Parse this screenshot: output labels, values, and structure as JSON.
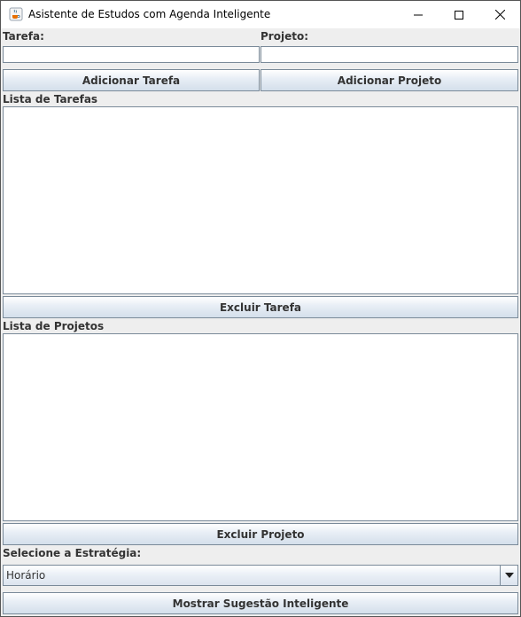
{
  "window": {
    "title": "Asistente de Estudos com Agenda Inteligente",
    "icon": "java-cup-icon"
  },
  "form": {
    "task_label": "Tarefa:",
    "task_value": "",
    "project_label": "Projeto:",
    "project_value": ""
  },
  "buttons": {
    "add_task": "Adicionar Tarefa",
    "add_project": "Adicionar Projeto",
    "delete_task": "Excluir Tarefa",
    "delete_project": "Excluir Projeto",
    "show_suggestion": "Mostrar Sugestão Inteligente"
  },
  "lists": {
    "tasks_label": "Lista de Tarefas",
    "tasks_items": [],
    "projects_label": "Lista de Projetos",
    "projects_items": []
  },
  "strategy": {
    "label": "Selecione a Estratégia:",
    "selected": "Horário"
  },
  "colors": {
    "button_border": "#7a8a99",
    "panel_bg": "#eeeeee",
    "label_text": "#333333"
  }
}
